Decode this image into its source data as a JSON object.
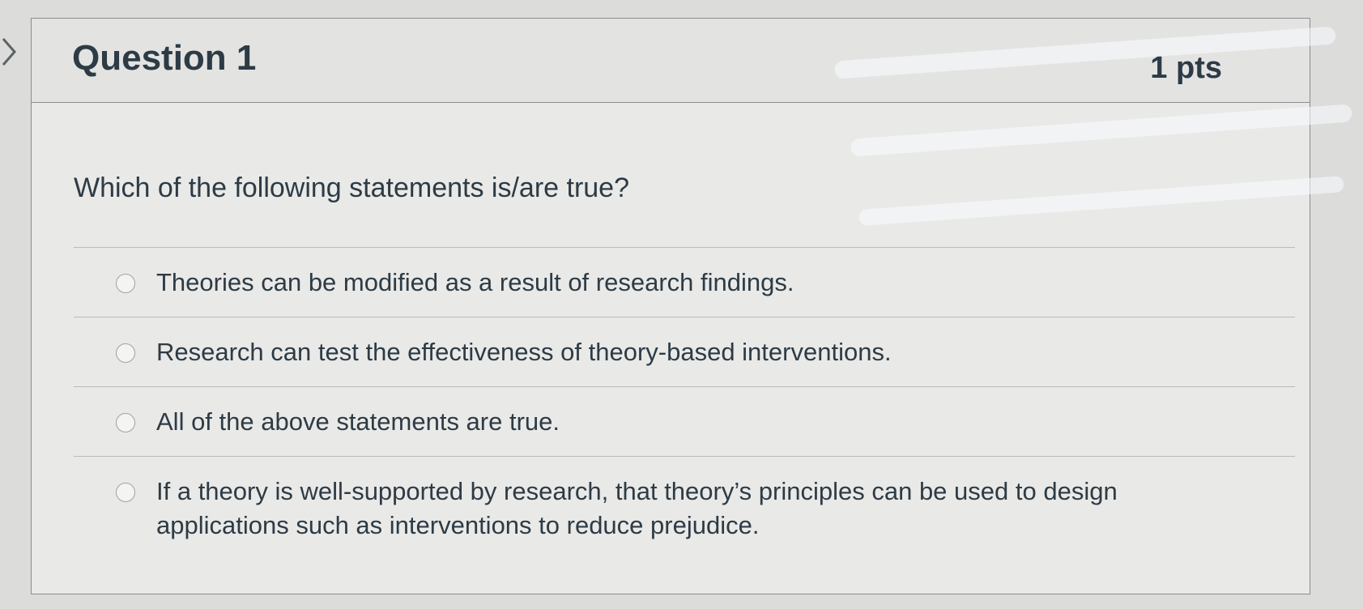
{
  "question": {
    "title": "Question 1",
    "points": "1 pts",
    "prompt": "Which of the following statements is/are true?",
    "answers": [
      "Theories can be modified as a result of research findings.",
      "Research can test the effectiveness of theory-based interventions.",
      "All of the above statements are true.",
      "If a theory is well-supported by research, that theory’s principles can be used to design applications such as interventions to reduce prejudice."
    ]
  },
  "icons": {
    "nav": "chevron-right-icon",
    "answer_marker": "radio-button"
  },
  "colors": {
    "page_background": "#dcdcda",
    "card_background": "#e9e9e7",
    "header_background": "#e3e4e2",
    "text": "#2d3b45",
    "border": "#8a8d8f"
  }
}
